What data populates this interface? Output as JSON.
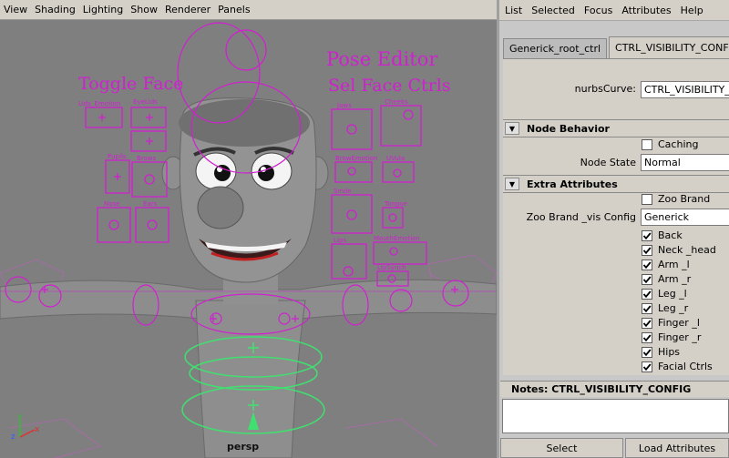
{
  "viewport": {
    "menu": [
      "View",
      "Shading",
      "Lighting",
      "Show",
      "Renderer",
      "Panels"
    ],
    "camera_label": "persp",
    "rig_labels": {
      "toggle_face": "Toggle Face",
      "pose_editor": "Pose Editor",
      "sel_face_ctrls": "Sel Face Ctrls",
      "lids_emotion": "Lids_Emotion",
      "eyelids": "EyeLids",
      "pupils": "Pupils",
      "brows": "Brows",
      "nose": "Nose",
      "ears": "Ears",
      "jaws": "Jaws",
      "cheeks": "Cheeks",
      "brow_emotion": "BrowEmotion",
      "uvula": "UVula",
      "smile": "Smile",
      "tongue": "Tongue",
      "lips": "Lips",
      "mouth_emotion": "MouthEmotion",
      "lip_sync": "LipSynch"
    },
    "axis": {
      "y": "y",
      "z": "z",
      "x": "x"
    }
  },
  "attribute_editor": {
    "menu": [
      "List",
      "Selected",
      "Focus",
      "Attributes",
      "Help"
    ],
    "tabs": [
      "Generick_root_ctrl",
      "CTRL_VISIBILITY_CONFIG"
    ],
    "active_tab": 1,
    "node_type_label": "nurbsCurve:",
    "node_name_value": "CTRL_VISIBILITY_CONFIG",
    "node_behavior": {
      "title": "Node Behavior",
      "caching_label": "Caching",
      "caching_checked": false,
      "node_state_label": "Node State",
      "node_state_value": "Normal"
    },
    "extra_attributes": {
      "title": "Extra Attributes",
      "zoo_brand_label": "Zoo Brand",
      "zoo_brand_checked": false,
      "vis_config_label": "Zoo Brand _vis Config",
      "vis_config_value": "Generick",
      "toggles": [
        {
          "label": "Back",
          "checked": true
        },
        {
          "label": "Neck _head",
          "checked": true
        },
        {
          "label": "Arm _l",
          "checked": true
        },
        {
          "label": "Arm _r",
          "checked": true
        },
        {
          "label": "Leg _l",
          "checked": true
        },
        {
          "label": "Leg _r",
          "checked": true
        },
        {
          "label": "Finger _l",
          "checked": true
        },
        {
          "label": "Finger _r",
          "checked": true
        },
        {
          "label": "Hips",
          "checked": true
        },
        {
          "label": "Facial Ctrls",
          "checked": true
        }
      ]
    },
    "notes_label": "Notes:  CTRL_VISIBILITY_CONFIG",
    "buttons": {
      "select": "Select",
      "load_attributes": "Load Attributes"
    }
  },
  "colors": {
    "control_magenta": "#d020d0",
    "control_green": "#40e070",
    "viewport_bg": "#7f7f7f",
    "panel_bg": "#d4d0c8"
  }
}
